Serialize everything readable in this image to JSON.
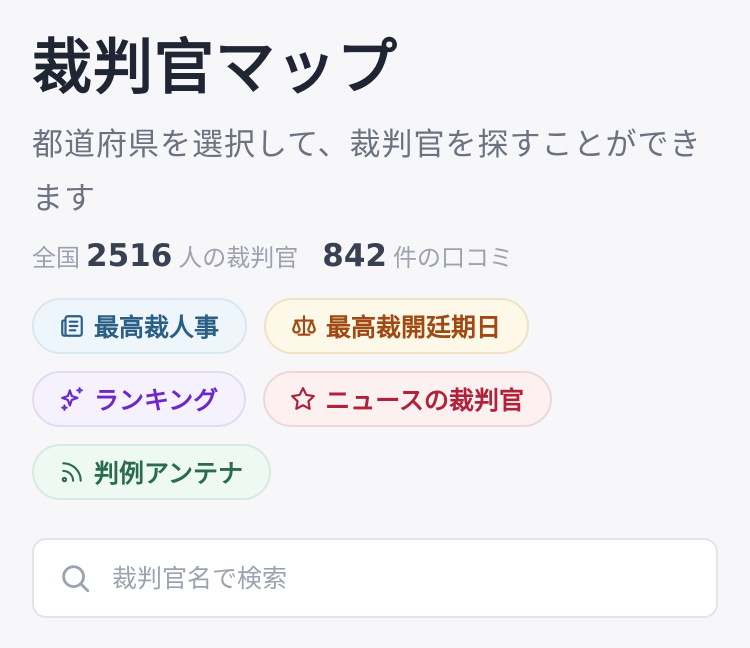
{
  "header": {
    "title": "裁判官マップ",
    "subtitle": "都道府県を選択して、裁判官を探すことができます"
  },
  "stats": {
    "prefix": "全国",
    "judges_count": "2516",
    "judges_suffix": "人の裁判官",
    "reviews_count": "842",
    "reviews_suffix": "件の口コミ"
  },
  "chips": [
    {
      "label": "最高裁人事",
      "icon": "newspaper-icon",
      "color": "#2b5f86"
    },
    {
      "label": "最高裁開廷期日",
      "icon": "scale-icon",
      "color": "#a04a13"
    },
    {
      "label": "ランキング",
      "icon": "sparkles-icon",
      "color": "#6d28c9"
    },
    {
      "label": "ニュースの裁判官",
      "icon": "star-icon",
      "color": "#b0223a"
    },
    {
      "label": "判例アンテナ",
      "icon": "rss-icon",
      "color": "#2a6d4a"
    }
  ],
  "search": {
    "placeholder": "裁判官名で検索",
    "value": ""
  }
}
